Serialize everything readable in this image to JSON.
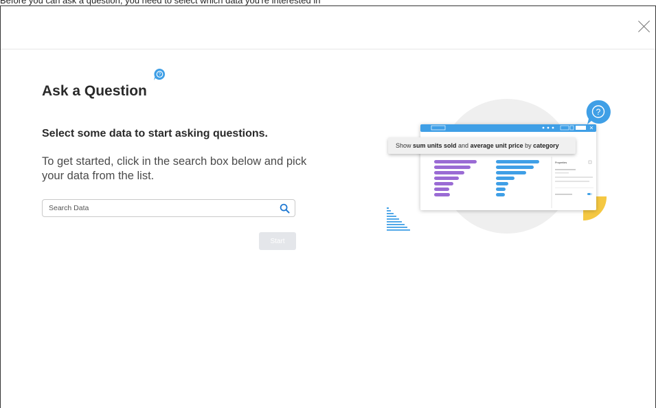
{
  "caption": "Before you can ask a question, you need to select which data you're interested in",
  "dialog": {
    "title": "Ask a Question",
    "subtitle": "Select some data to start asking questions.",
    "description": "To get started, click in the search box below and pick your data from the list.",
    "search": {
      "placeholder": "Search Data",
      "value": ""
    },
    "start_label": "Start",
    "close_icon": "close-icon",
    "title_icon": "question-bubble-icon"
  },
  "illustration": {
    "prompt_parts": [
      "Show ",
      "sum units sold",
      " and ",
      "average unit price",
      " by ",
      "category"
    ],
    "panel_label": "Properties"
  },
  "colors": {
    "accent": "#3f9fe6",
    "purple": "#9a6bd4",
    "yellow": "#f5c842",
    "disabled_button": "#e4e6ea"
  }
}
